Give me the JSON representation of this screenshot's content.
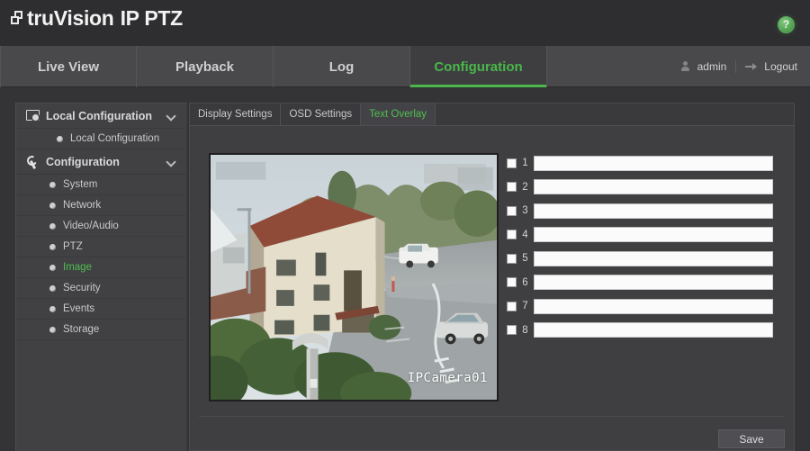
{
  "header": {
    "logo_primary": "truVision",
    "logo_secondary": "IP PTZ",
    "logo_icon": "stacked-squares-icon",
    "help_icon": "question-mark-icon",
    "help_label": "?"
  },
  "nav": {
    "tabs": [
      {
        "label": "Live View",
        "active": false
      },
      {
        "label": "Playback",
        "active": false
      },
      {
        "label": "Log",
        "active": false
      },
      {
        "label": "Configuration",
        "active": true
      }
    ],
    "user": {
      "user_icon": "person-icon",
      "username": "admin",
      "logout_icon": "logout-arrow-icon",
      "logout_label": "Logout"
    }
  },
  "sidebar": {
    "groups": [
      {
        "label": "Local Configuration",
        "icon": "monitor-gear-icon",
        "chevron": "chevron-down-icon",
        "items": [
          {
            "label": "Local Configuration",
            "active": false
          }
        ]
      },
      {
        "label": "Configuration",
        "icon": "wrench-icon",
        "chevron": "chevron-down-icon",
        "items": [
          {
            "label": "System",
            "active": false
          },
          {
            "label": "Network",
            "active": false
          },
          {
            "label": "Video/Audio",
            "active": false
          },
          {
            "label": "PTZ",
            "active": false
          },
          {
            "label": "Image",
            "active": true
          },
          {
            "label": "Security",
            "active": false
          },
          {
            "label": "Events",
            "active": false
          },
          {
            "label": "Storage",
            "active": false
          }
        ]
      }
    ]
  },
  "content": {
    "tabs": [
      {
        "label": "Display Settings",
        "active": false
      },
      {
        "label": "OSD Settings",
        "active": false
      },
      {
        "label": "Text Overlay",
        "active": true
      }
    ],
    "preview": {
      "osd_text": "IPCamera01",
      "description": "live camera view of street and building"
    },
    "overlay_rows": [
      {
        "number": "1",
        "checked": false,
        "value": ""
      },
      {
        "number": "2",
        "checked": false,
        "value": ""
      },
      {
        "number": "3",
        "checked": false,
        "value": ""
      },
      {
        "number": "4",
        "checked": false,
        "value": ""
      },
      {
        "number": "5",
        "checked": false,
        "value": ""
      },
      {
        "number": "6",
        "checked": false,
        "value": ""
      },
      {
        "number": "7",
        "checked": false,
        "value": ""
      },
      {
        "number": "8",
        "checked": false,
        "value": ""
      }
    ],
    "save_label": "Save"
  },
  "colors": {
    "accent_green": "#49b749",
    "header_bg": "#2e2e30",
    "nav_bg": "#49494c",
    "page_bg": "#343436",
    "panel_bg": "#3f3f42"
  }
}
